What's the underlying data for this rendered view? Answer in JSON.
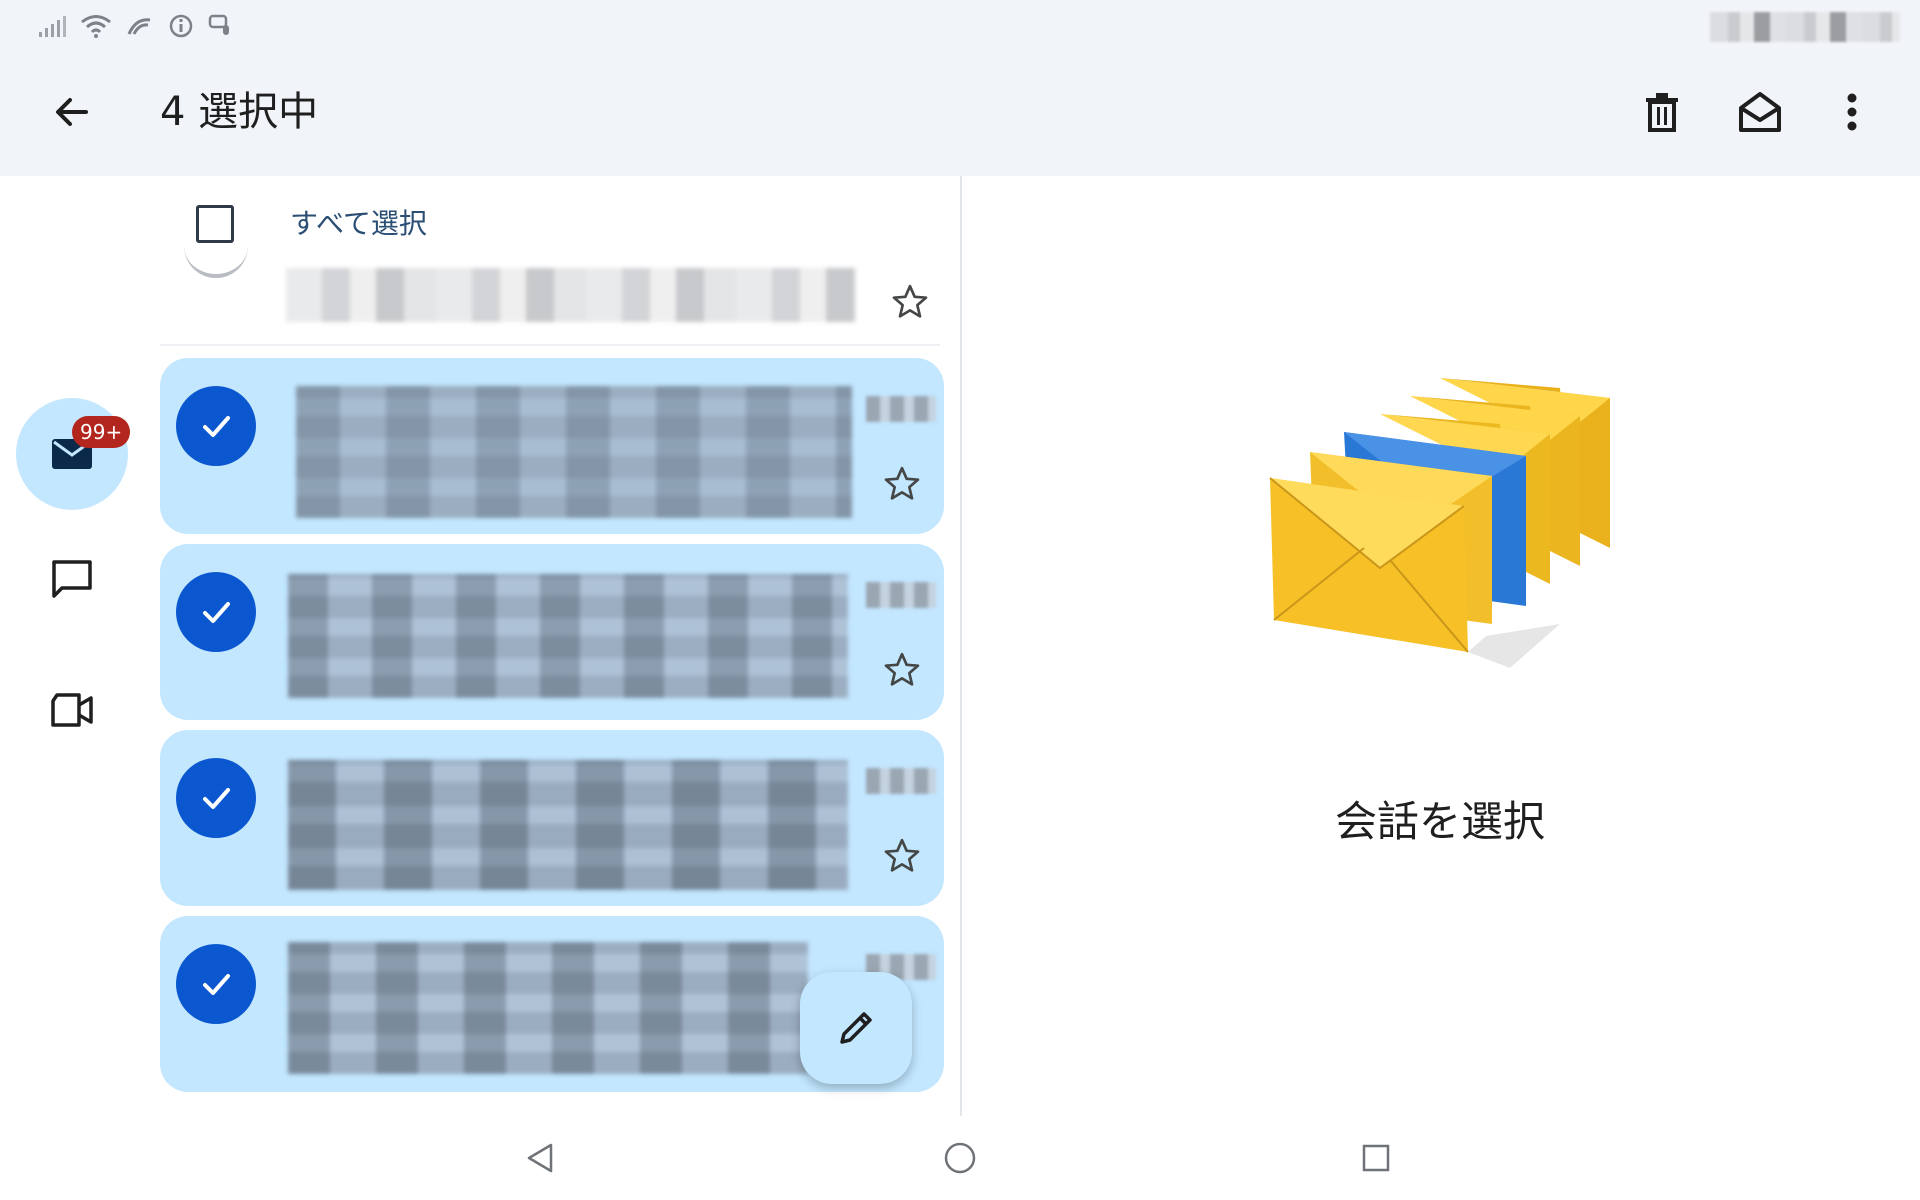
{
  "status_bar": {
    "icons": [
      "signal-icon",
      "wifi-icon",
      "nfc-icon",
      "info-icon",
      "assistant-icon"
    ]
  },
  "app_bar": {
    "selection_title": "4 選択中",
    "back_icon": "arrow-left-icon",
    "actions": [
      "trash-icon",
      "mail-open-icon",
      "more-vert-icon"
    ]
  },
  "rail": {
    "mail_badge": "99+",
    "items": [
      "mail-icon",
      "chat-icon",
      "video-icon"
    ]
  },
  "list": {
    "select_all_label": "すべて選択",
    "selected_rows": 4
  },
  "detail": {
    "empty_label": "会話を選択"
  },
  "colors": {
    "app_bar_bg": "#f1f4f9",
    "selected_row_bg": "#c2e7ff",
    "check_blue": "#0b57d0",
    "badge_red": "#b3261e",
    "envelope_yellow": "#f6c026",
    "envelope_blue": "#2a78d6"
  }
}
